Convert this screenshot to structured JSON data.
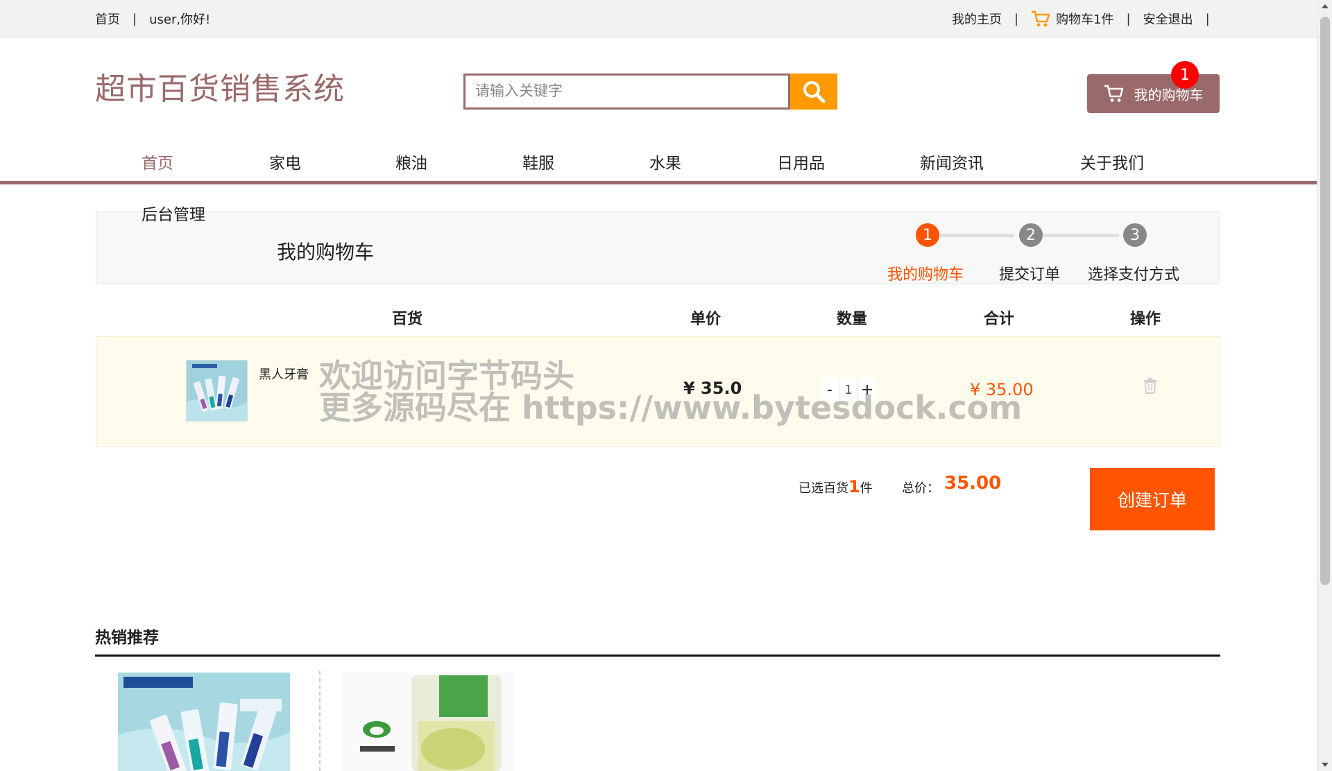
{
  "topbar": {
    "home": "首页",
    "sep": "|",
    "greeting": "user,你好!",
    "my_home": "我的主页",
    "cart_count_label": "购物车1件",
    "logout": "安全退出"
  },
  "header": {
    "logo": "超市百货销售系统",
    "search_placeholder": "请输入关键字",
    "my_cart": "我的购物车",
    "cart_badge": "1"
  },
  "nav": {
    "items": [
      "首页",
      "家电",
      "粮油",
      "鞋服",
      "水果",
      "日用品",
      "新闻资讯",
      "关于我们"
    ],
    "admin": "后台管理"
  },
  "cart": {
    "title": "我的购物车",
    "steps": [
      {
        "num": "1",
        "label": "我的购物车"
      },
      {
        "num": "2",
        "label": "提交订单"
      },
      {
        "num": "3",
        "label": "选择支付方式"
      }
    ],
    "columns": [
      "百货",
      "单价",
      "数量",
      "合计",
      "操作"
    ],
    "items": [
      {
        "name": "黑人牙膏",
        "price": "¥ 35.0",
        "qty": "1",
        "subtotal": "¥ 35.00",
        "minus": "-",
        "plus": "+"
      }
    ],
    "summary": {
      "selected_prefix": "已选百货",
      "selected_count": "1",
      "selected_suffix": "件",
      "total_label": "总价：",
      "total": "35.00",
      "create_order": "创建订单"
    }
  },
  "watermark": {
    "line1": "欢迎访问字节码头",
    "line2": "更多源码尽在  https://www.bytesdock.com"
  },
  "hot": {
    "title": "热销推荐"
  },
  "colors": {
    "brand": "#9a6a6a",
    "accent": "#ff5500",
    "search_button": "#ff9a00",
    "badge": "#ff0000"
  }
}
